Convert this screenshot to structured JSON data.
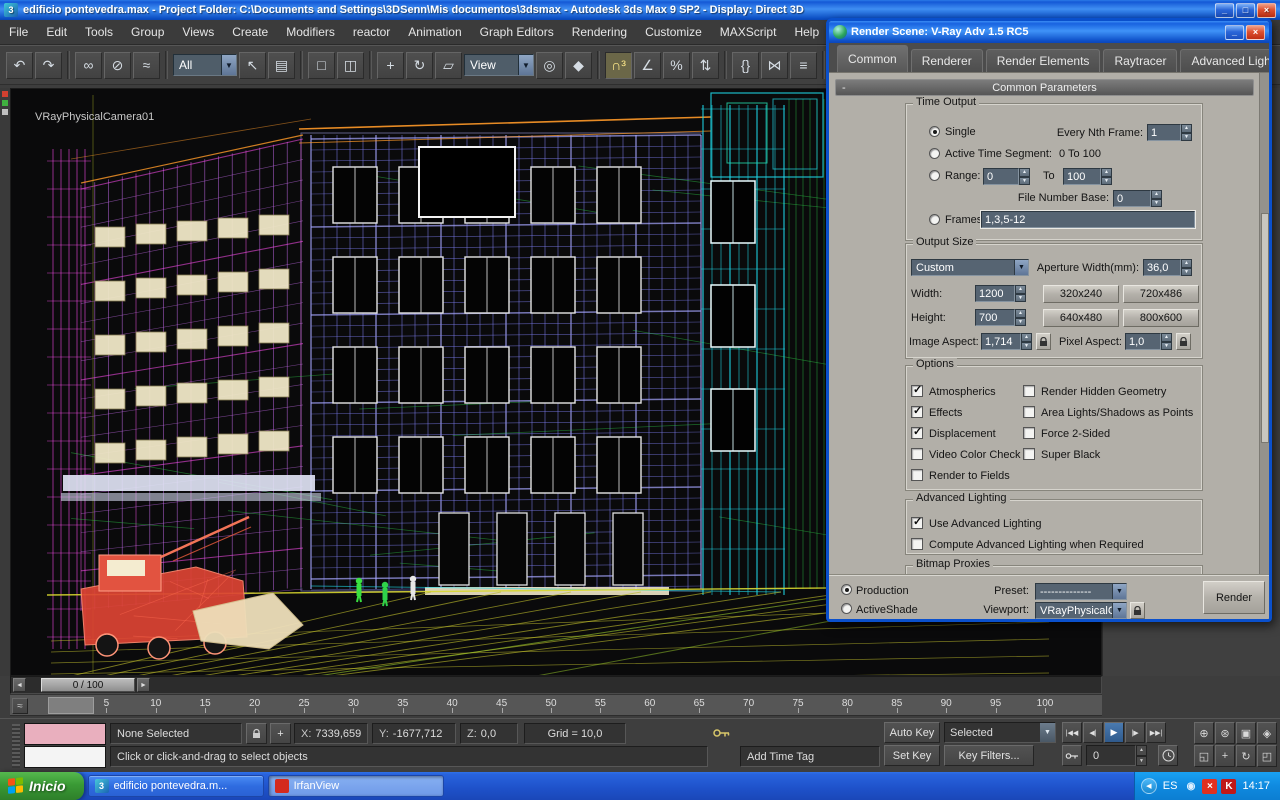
{
  "titlebar": {
    "title": "edificio pontevedra.max    - Project Folder: C:\\Documents and Settings\\3DSenn\\Mis documentos\\3dsmax    - Autodesk 3ds Max 9 SP2   -  Display: Direct 3D"
  },
  "menu": {
    "items": [
      "File",
      "Edit",
      "Tools",
      "Group",
      "Views",
      "Create",
      "Modifiers",
      "reactor",
      "Animation",
      "Graph Editors",
      "Rendering",
      "Customize",
      "MAXScript",
      "Help"
    ]
  },
  "toolbar": {
    "items": [
      {
        "t": "b",
        "n": "undo-button",
        "g": "↶"
      },
      {
        "t": "b",
        "n": "redo-button",
        "g": "↷"
      },
      {
        "t": "s"
      },
      {
        "t": "b",
        "n": "select-and-link-button",
        "g": "∞"
      },
      {
        "t": "b",
        "n": "unlink-selection-button",
        "g": "⊘"
      },
      {
        "t": "b",
        "n": "bind-to-space-warp-button",
        "g": "≈"
      },
      {
        "t": "s"
      },
      {
        "t": "c",
        "n": "selection-filter-dropdown",
        "v": "All",
        "w": 64
      },
      {
        "t": "b",
        "n": "select-object-button",
        "g": "↖"
      },
      {
        "t": "b",
        "n": "select-by-name-button",
        "g": "▤"
      },
      {
        "t": "s"
      },
      {
        "t": "b",
        "n": "rectangular-selection-region-button",
        "g": "□"
      },
      {
        "t": "b",
        "n": "window-crossing-toggle",
        "g": "◫"
      },
      {
        "t": "s"
      },
      {
        "t": "b",
        "n": "select-and-move-button",
        "g": "+"
      },
      {
        "t": "b",
        "n": "select-and-rotate-button",
        "g": "↻"
      },
      {
        "t": "b",
        "n": "select-and-scale-button",
        "g": "▱"
      },
      {
        "t": "c",
        "n": "reference-coordinate-system-dropdown",
        "v": "View",
        "w": 70
      },
      {
        "t": "b",
        "n": "use-pivot-point-center-button",
        "g": "◎"
      },
      {
        "t": "b",
        "n": "select-and-manipulate-button",
        "g": "◆"
      },
      {
        "t": "s"
      },
      {
        "t": "b",
        "n": "snaps-toggle-button",
        "g": "∩³",
        "a": true
      },
      {
        "t": "b",
        "n": "angle-snap-toggle-button",
        "g": "∠"
      },
      {
        "t": "b",
        "n": "percent-snap-toggle-button",
        "g": "%"
      },
      {
        "t": "b",
        "n": "spinner-snap-toggle-button",
        "g": "⇅"
      },
      {
        "t": "s"
      },
      {
        "t": "b",
        "n": "edit-named-selection-sets-button",
        "g": "{}"
      },
      {
        "t": "b",
        "n": "mirror-button",
        "g": "⋈"
      },
      {
        "t": "b",
        "n": "align-button",
        "g": "≡"
      },
      {
        "t": "s"
      },
      {
        "t": "b",
        "n": "layer-manager-button",
        "g": "≣"
      },
      {
        "t": "b",
        "n": "curve-editor-button",
        "g": "∫"
      },
      {
        "t": "b",
        "n": "schematic-view-button",
        "g": "⊞"
      },
      {
        "t": "s"
      },
      {
        "t": "b",
        "n": "material-editor-button",
        "g": "◉"
      },
      {
        "t": "b",
        "n": "render-scene-dialog-button",
        "g": "▦"
      },
      {
        "t": "b",
        "n": "quick-render-button",
        "g": "►"
      }
    ]
  },
  "viewport": {
    "camera_label": "VRayPhysicalCamera01",
    "palette": {
      "violet": "#7d7df0",
      "violet_bright": "#a6a6ff",
      "magenta": "#c86cf0",
      "magenta_bright": "#ff58f0",
      "pink": "#ff4df0",
      "cyan": "#1fd8e8",
      "green": "#2fd24a",
      "yellow": "#d8d62e",
      "orange": "#ff9a28",
      "red": "#dd4434",
      "red_light": "#ff8a70",
      "cream": "#efe7c6",
      "slab": "#dfe3f4",
      "white": "#ececec"
    }
  },
  "render_dialog": {
    "title": "Render Scene: V-Ray Adv 1.5 RC5",
    "tabs": [
      "Common",
      "Renderer",
      "Render Elements",
      "Raytracer",
      "Advanced Lighting"
    ],
    "active_tab": "Common",
    "rollout": "Common Parameters",
    "time_output": {
      "legend": "Time Output",
      "single": "Single",
      "every_nth": "Every Nth Frame:",
      "every_nth_value": "1",
      "active_segment": "Active Time Segment:",
      "active_segment_value": "0 To 100",
      "range": "Range:",
      "range_from": "0",
      "to": "To",
      "range_to": "100",
      "file_number": "File Number Base:",
      "file_number_value": "0",
      "frames": "Frames",
      "frames_value": "1,3,5-12",
      "selected": "Single"
    },
    "output_size": {
      "legend": "Output Size",
      "preset": "Custom",
      "aperture": "Aperture Width(mm):",
      "aperture_value": "36,0",
      "width": "Width:",
      "width_value": "1200",
      "height": "Height:",
      "height_value": "700",
      "res_buttons": [
        "320x240",
        "720x486",
        "640x480",
        "800x600"
      ],
      "image_aspect": "Image Aspect:",
      "image_aspect_value": "1,714",
      "pixel_aspect": "Pixel Aspect:",
      "pixel_aspect_value": "1,0"
    },
    "options": {
      "legend": "Options",
      "col1": [
        {
          "label": "Atmospherics",
          "checked": true
        },
        {
          "label": "Effects",
          "checked": true
        },
        {
          "label": "Displacement",
          "checked": true
        },
        {
          "label": "Video Color Check",
          "checked": false
        },
        {
          "label": "Render to Fields",
          "checked": false
        }
      ],
      "col2": [
        {
          "label": "Render Hidden Geometry",
          "checked": false
        },
        {
          "label": "Area Lights/Shadows as Points",
          "checked": false
        },
        {
          "label": "Force 2-Sided",
          "checked": false
        },
        {
          "label": "Super Black",
          "checked": false
        }
      ]
    },
    "advanced_lighting": {
      "legend": "Advanced Lighting",
      "items": [
        {
          "label": "Use Advanced Lighting",
          "checked": true
        },
        {
          "label": "Compute Advanced Lighting when Required",
          "checked": false
        }
      ]
    },
    "bitmap_proxies": {
      "legend": "Bitmap Proxies"
    },
    "footer": {
      "production": "Production",
      "activeshade": "ActiveShade",
      "target_selected": "Production",
      "preset_label": "Preset:",
      "preset_value": "--------------",
      "viewport_label": "Viewport:",
      "viewport_value": "VRayPhysicalC...",
      "render": "Render"
    }
  },
  "timeline": {
    "slider_label": "0 / 100",
    "ticks": [
      5,
      10,
      15,
      20,
      25,
      30,
      35,
      40,
      45,
      50,
      55,
      60,
      65,
      70,
      75,
      80,
      85,
      90,
      95,
      100
    ]
  },
  "status_bar": {
    "selection_text": "None Selected",
    "prompt": "Click or click-and-drag to select objects",
    "x_label": "X:",
    "x_value": "7339,659",
    "y_label": "Y:",
    "y_value": "-1677,712",
    "z_label": "Z:",
    "z_value": "0,0",
    "grid_text": "Grid = 10,0",
    "add_time_tag": "Add Time Tag",
    "auto_key": "Auto Key",
    "set_key": "Set Key",
    "key_selection": "Selected",
    "key_filters": "Key Filters...",
    "frame_value": "0",
    "playback": [
      {
        "name": "go-to-start-button",
        "glyph": "|◀◀"
      },
      {
        "name": "previous-key-button",
        "glyph": "◀|"
      },
      {
        "name": "play-animation-button",
        "glyph": "▶",
        "active": true
      },
      {
        "name": "next-key-button",
        "glyph": "|▶"
      },
      {
        "name": "go-to-end-button",
        "glyph": "▶▶|"
      }
    ],
    "nav": [
      {
        "name": "zoom-button",
        "glyph": "⊕"
      },
      {
        "name": "zoom-all-button",
        "glyph": "⊛"
      },
      {
        "name": "zoom-extents-button",
        "glyph": "▣"
      },
      {
        "name": "zoom-extents-all-button",
        "glyph": "◈"
      },
      {
        "name": "zoom-region-button",
        "glyph": "◱"
      },
      {
        "name": "pan-view-button",
        "glyph": "+"
      },
      {
        "name": "arc-rotate-button",
        "glyph": "↻"
      },
      {
        "name": "maximize-viewport-toggle",
        "glyph": "◰"
      }
    ]
  },
  "taskbar": {
    "start_label": "Inicio",
    "tasks": [
      {
        "label": "edificio pontevedra.m...",
        "icon": "max",
        "icon_glyph": "3",
        "pressed": false
      },
      {
        "label": "IrfanView",
        "icon": "irfan",
        "icon_glyph": "",
        "pressed": true
      }
    ],
    "language": "ES",
    "time": "14:17",
    "tray_icons": [
      {
        "name": "network-tray-icon",
        "glyph": "◉",
        "fg": "#dff0ff",
        "bg": "transparent"
      },
      {
        "name": "alert-tray-icon",
        "glyph": "×",
        "fg": "#ffffff",
        "bg": "#e03020"
      },
      {
        "name": "antivirus-tray-icon",
        "glyph": "K",
        "fg": "#ffffff",
        "bg": "#c01818"
      }
    ]
  },
  "colors": {
    "xp_blue": "#2160d8",
    "start_green": "#3da33c",
    "tray_blue": "#0f9af0",
    "dialog_field": "#566472",
    "viewport_bg": "#0a0a0b",
    "accent_orange": "#ff9a28"
  }
}
